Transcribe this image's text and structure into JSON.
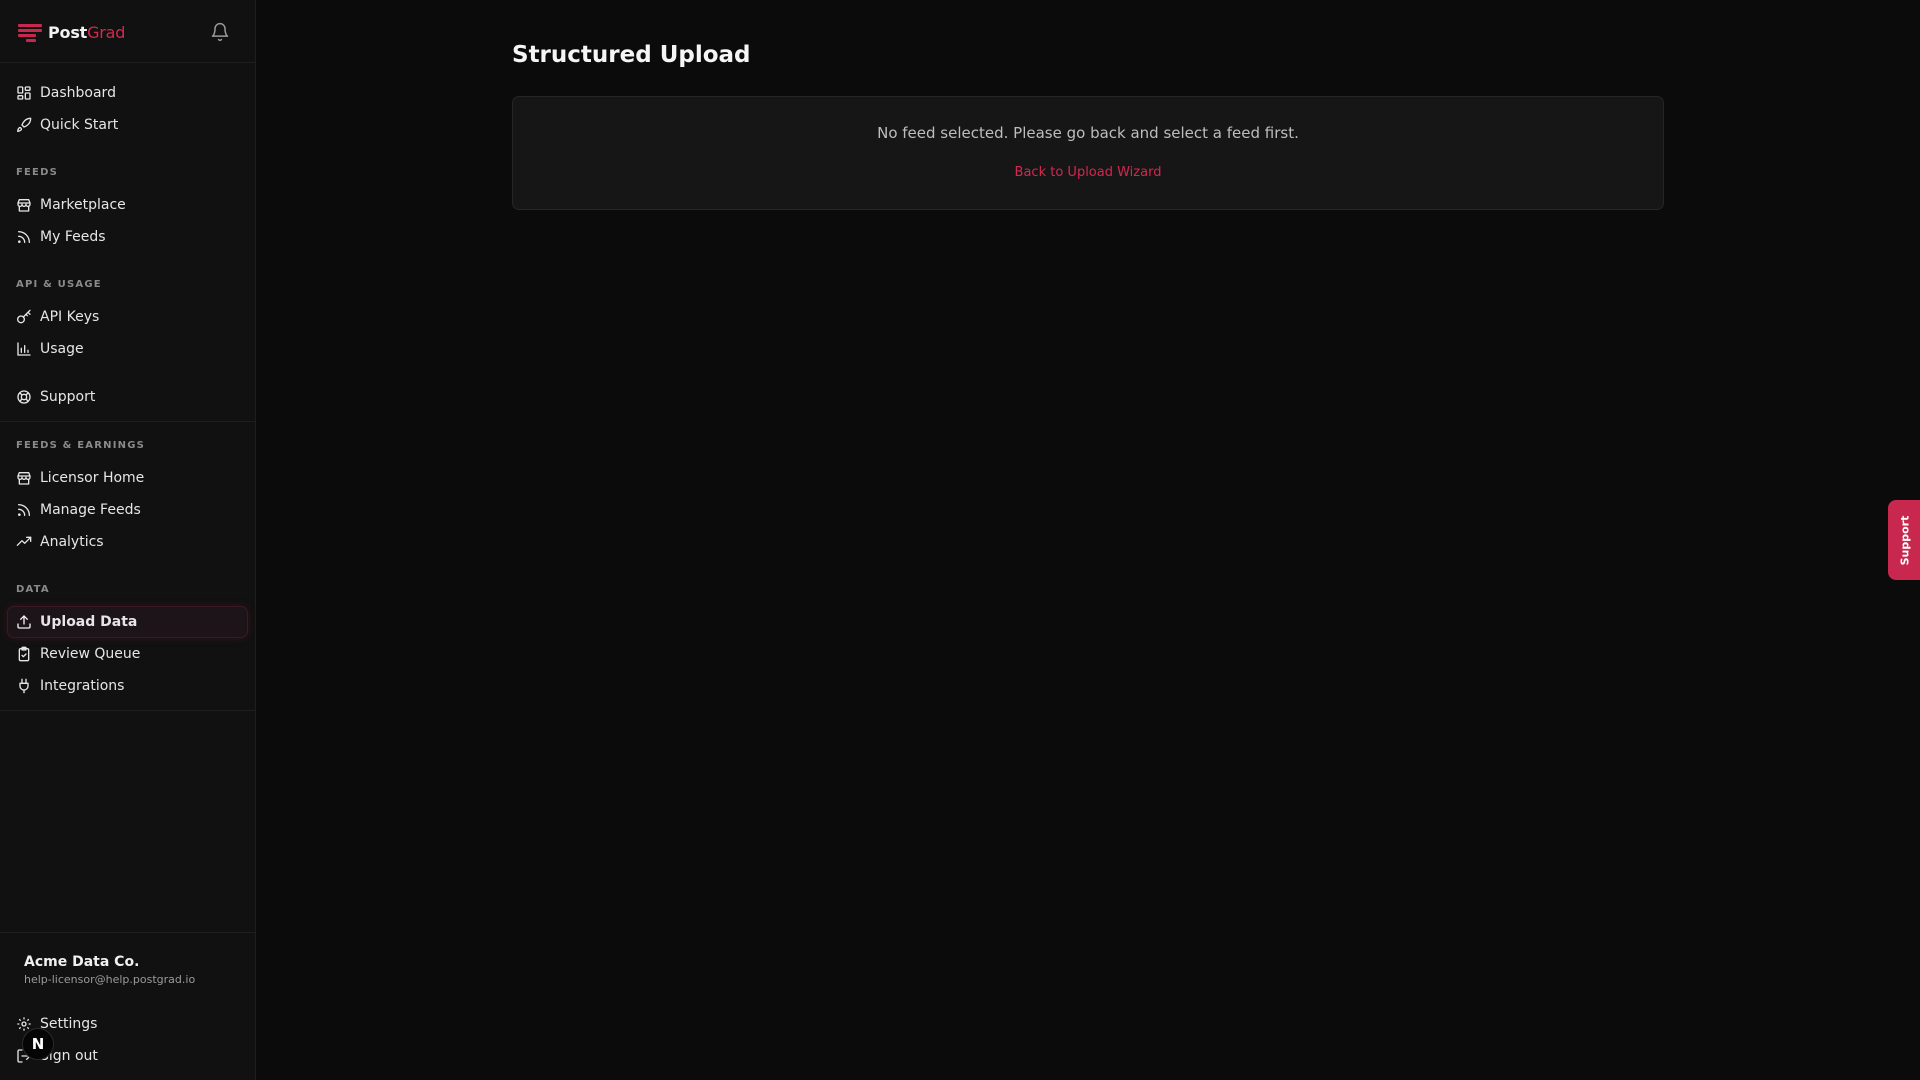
{
  "brand": {
    "part1": "Post",
    "part2": "Grad"
  },
  "nav_top": [
    {
      "label": "Dashboard",
      "icon": "dashboard-icon"
    },
    {
      "label": "Quick Start",
      "icon": "rocket-icon"
    }
  ],
  "sections": {
    "feeds": "FEEDS",
    "api_usage": "API & USAGE",
    "feeds_earnings": "FEEDS & EARNINGS",
    "data": "DATA"
  },
  "nav_feeds": [
    {
      "label": "Marketplace",
      "icon": "store-icon"
    },
    {
      "label": "My Feeds",
      "icon": "rss-icon"
    }
  ],
  "nav_api": [
    {
      "label": "API Keys",
      "icon": "key-icon"
    },
    {
      "label": "Usage",
      "icon": "bar-chart-icon"
    }
  ],
  "nav_support": {
    "label": "Support",
    "icon": "lifebuoy-icon"
  },
  "nav_earnings": [
    {
      "label": "Licensor Home",
      "icon": "store-icon"
    },
    {
      "label": "Manage Feeds",
      "icon": "rss-icon"
    },
    {
      "label": "Analytics",
      "icon": "trending-up-icon"
    }
  ],
  "nav_data": [
    {
      "label": "Upload Data",
      "icon": "upload-icon",
      "active": true
    },
    {
      "label": "Review Queue",
      "icon": "clipboard-check-icon"
    },
    {
      "label": "Integrations",
      "icon": "plug-icon"
    }
  ],
  "account": {
    "name": "Acme Data Co.",
    "email": "help-licensor@help.postgrad.io"
  },
  "footer_nav": [
    {
      "label": "Settings",
      "icon": "gear-icon"
    },
    {
      "label": "Sign out",
      "icon": "sign-out-icon"
    }
  ],
  "overlay_badge": "N",
  "main": {
    "title": "Structured Upload",
    "message": "No feed selected. Please go back and select a feed first.",
    "link": "Back to Upload Wizard"
  },
  "support_tab": "Support",
  "colors": {
    "accent": "#d7264f",
    "background": "#0b0b0b",
    "sidebar": "#111111",
    "panel": "#161616"
  }
}
